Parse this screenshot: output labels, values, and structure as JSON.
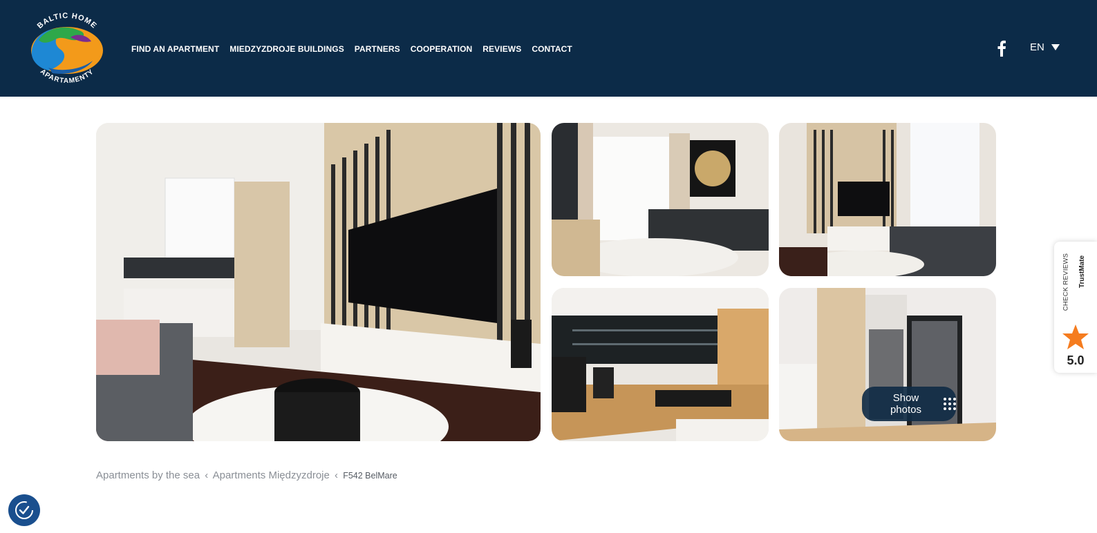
{
  "header": {
    "logo": {
      "top_text": "BALTIC HOME",
      "bottom_text": "APARTAMENTY"
    },
    "nav": [
      "FIND AN APARTMENT",
      "MIEDZYZDROJE BUILDINGS",
      "PARTNERS",
      "COOPERATION",
      "REVIEWS",
      "CONTACT"
    ],
    "social_icon": "facebook-icon",
    "language": "EN"
  },
  "gallery": {
    "photos": [
      "living-room-tv-wall",
      "living-room-sofa",
      "living-room-tv-sofa",
      "kitchen-counter",
      "entrance-hallway"
    ],
    "show_photos_label": "Show photos"
  },
  "breadcrumb": {
    "items": [
      "Apartments by the sea",
      "Apartments Międzyzdroje"
    ],
    "separator": "‹",
    "current": "F542 BelMare"
  },
  "trustmate": {
    "label": "CHECK REVIEWS",
    "brand": "TrustMate",
    "score": "5.0",
    "accent": "#f57c1f"
  },
  "colors": {
    "header_bg": "#0c2b48",
    "button_bg": "#112d45",
    "accessibility_bg": "#1a4f8e"
  }
}
